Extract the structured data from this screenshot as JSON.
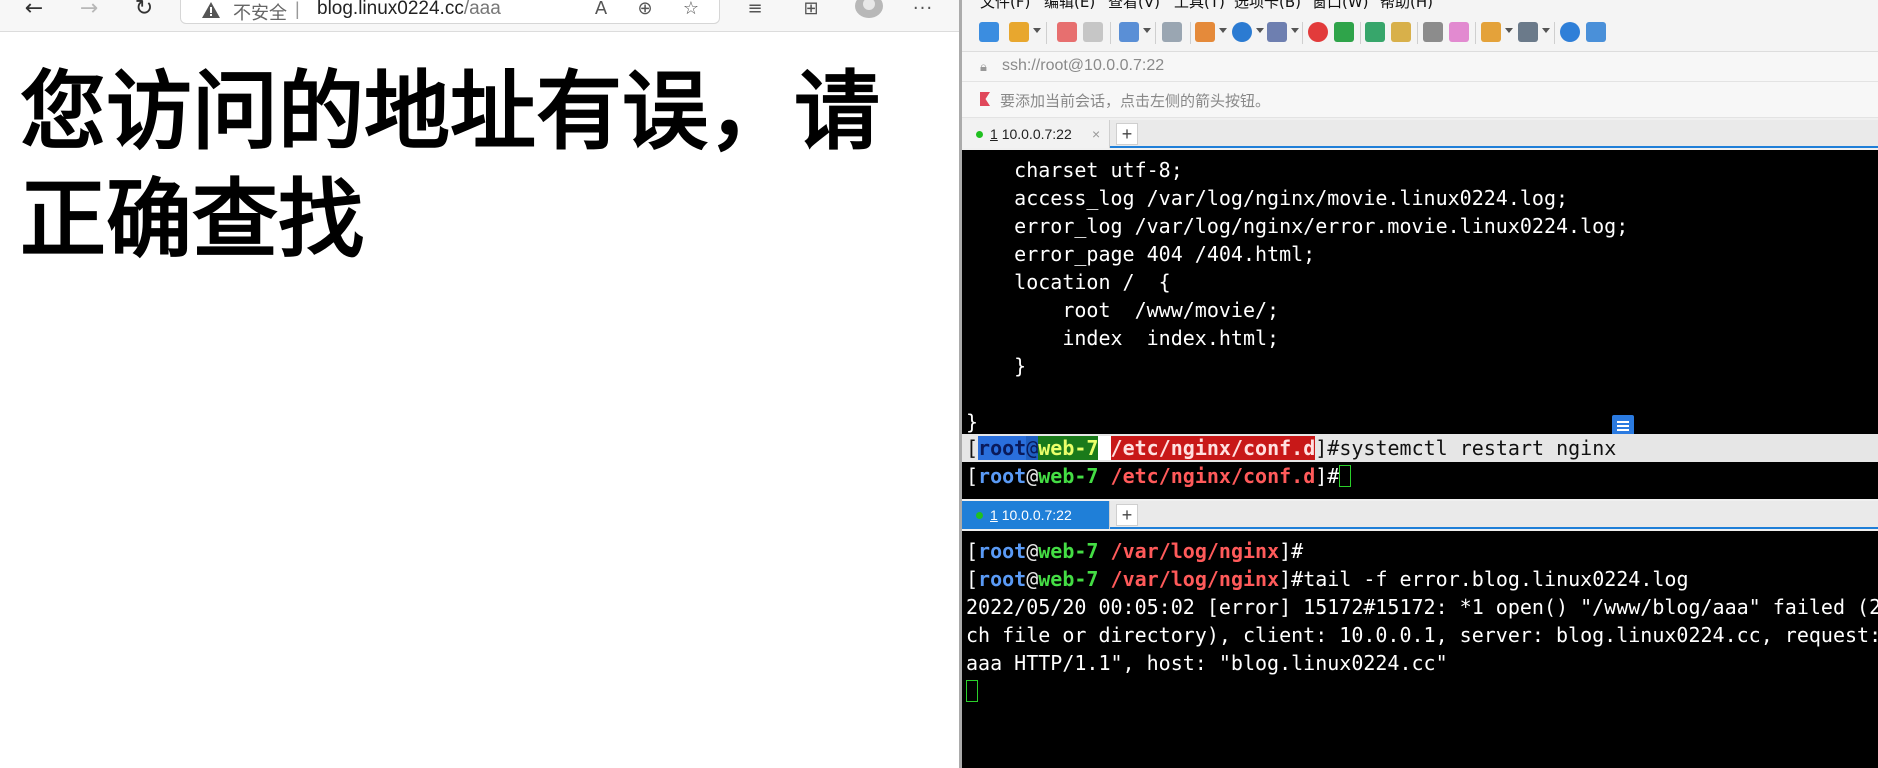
{
  "browser": {
    "security_label": "不安全",
    "separator": "|",
    "url_host": "blog.linux0224.cc",
    "url_path": "/aaa",
    "heading": "您访问的地址有误，请正确查找",
    "icons": {
      "back": "back-arrow-icon",
      "forward": "forward-arrow-icon",
      "refresh": "refresh-icon",
      "warning": "warning-icon",
      "read_aloud": "read-aloud-icon",
      "zoom": "zoom-icon",
      "add_favorite": "add-favorite-icon",
      "favorites": "favorites-icon",
      "collections": "collections-icon",
      "profile": "profile-avatar",
      "more": "more-dots-icon"
    }
  },
  "xshell": {
    "menu": [
      "文件(F)",
      "编辑(E)",
      "查看(V)",
      "工具(T)",
      "选项卡(B)",
      "窗口(W)",
      "帮助(H)"
    ],
    "address": "ssh://root@10.0.0.7:22",
    "hint": "要添加当前会话，点击左侧的箭头按钮。",
    "tabs": [
      {
        "number": "1",
        "label": "10.0.0.7:22"
      },
      {
        "number": "1",
        "label": "10.0.0.7:22"
      }
    ],
    "tab_close": "×",
    "tab_add": "+",
    "prompt": {
      "user": "root",
      "at": "@",
      "host": "web-7"
    },
    "term1": {
      "lines": [
        "    charset utf-8;",
        "    access_log /var/log/nginx/movie.linux0224.log;",
        "    error_log /var/log/nginx/error.movie.linux0224.log;",
        "    error_page 404 /404.html;",
        "    location /  {",
        "        root  /www/movie/;",
        "        index  index.html;",
        "    }",
        "",
        "}"
      ],
      "cwd": "/etc/nginx/conf.d",
      "command": "systemctl restart nginx"
    },
    "term2": {
      "cwd": "/var/log/nginx",
      "command": "tail -f error.blog.linux0224.log",
      "log_lines": [
        "2022/05/20 00:05:02 [error] 15172#15172: *1 open() \"/www/blog/aaa\" failed (2",
        "ch file or directory), client: 10.0.0.1, server: blog.linux0224.cc, request:",
        "aaa HTTP/1.1\", host: \"blog.linux0224.cc\""
      ]
    },
    "colors": {
      "prompt_user": "#5a9af5",
      "prompt_host": "#44dd44",
      "prompt_path": "#ff5a5a",
      "active_tab": "#1f7fd8",
      "cursor": "#2ad02a"
    }
  }
}
